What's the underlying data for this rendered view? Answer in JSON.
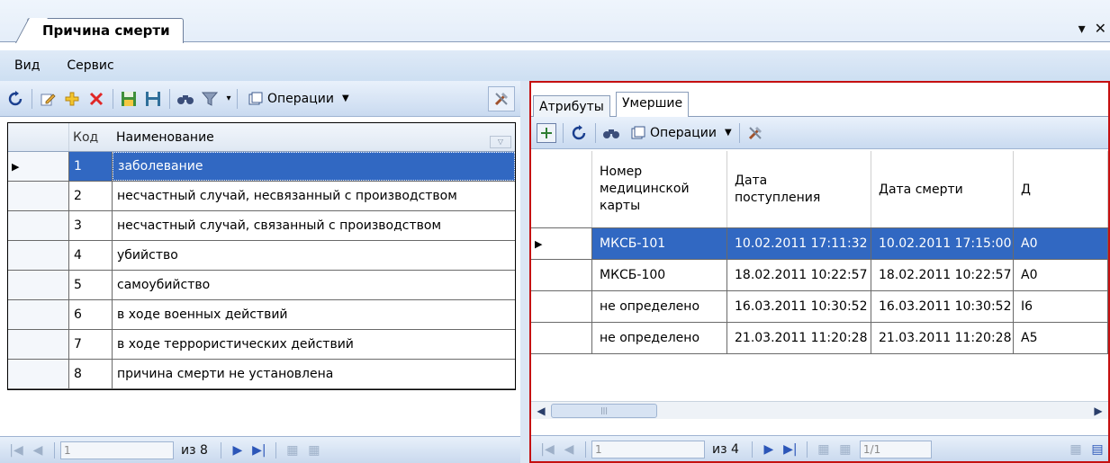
{
  "window": {
    "tab_title": "Причина смерти",
    "pin_glyph": "▾",
    "close_glyph": "✕"
  },
  "menu": {
    "items": [
      "Вид",
      "Сервис"
    ]
  },
  "left_toolbar": {
    "operations_label": "Операции",
    "icons": [
      "refresh-icon",
      "edit-icon",
      "add-icon",
      "delete-icon",
      "save-icon",
      "save-all-icon",
      "find-icon",
      "filter-icon",
      "operations-icon",
      "tools-icon"
    ]
  },
  "left_grid": {
    "columns": {
      "kod": "Код",
      "name": "Наименование"
    },
    "rows": [
      {
        "kod": "1",
        "name": "заболевание"
      },
      {
        "kod": "2",
        "name": "несчастный случай, несвязанный с производством"
      },
      {
        "kod": "3",
        "name": "несчастный случай, связанный с производством"
      },
      {
        "kod": "4",
        "name": "убийство"
      },
      {
        "kod": "5",
        "name": "самоубийство"
      },
      {
        "kod": "6",
        "name": "в ходе военных действий"
      },
      {
        "kod": "7",
        "name": "в ходе террористических действий"
      },
      {
        "kod": "8",
        "name": "причина смерти не установлена"
      }
    ],
    "selected_index": 0
  },
  "left_nav": {
    "position": "1",
    "of_label": "из 8"
  },
  "right_tabs": {
    "attributes": "Атрибуты",
    "deceased": "Умершие"
  },
  "right_toolbar": {
    "operations_label": "Операции"
  },
  "right_grid": {
    "columns": {
      "card_number": "Номер медицинской карты",
      "admission_date": "Дата поступления",
      "death_date": "Дата смерти",
      "extra": "Д"
    },
    "rows": [
      {
        "card_number": "МКСБ-101",
        "admission_date": "10.02.2011 17:11:32",
        "death_date": "10.02.2011 17:15:00",
        "extra": "А0"
      },
      {
        "card_number": "МКСБ-100",
        "admission_date": "18.02.2011 10:22:57",
        "death_date": "18.02.2011 10:22:57",
        "extra": "А0"
      },
      {
        "card_number": "не определено",
        "admission_date": "16.03.2011 10:30:52",
        "death_date": "16.03.2011 10:30:52",
        "extra": "I6"
      },
      {
        "card_number": "не определено",
        "admission_date": "21.03.2011 11:20:28",
        "death_date": "21.03.2011 11:20:28",
        "extra": "А5"
      }
    ],
    "selected_index": 0
  },
  "right_nav": {
    "position": "1",
    "of_label": "из 4",
    "page": "1/1"
  },
  "colors": {
    "selection": "#3168c2",
    "highlight_border": "#c51010",
    "toolbar": "#c9daf0"
  }
}
